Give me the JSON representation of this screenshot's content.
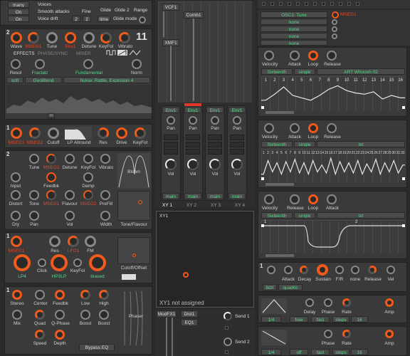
{
  "osc_header": {
    "many": "many",
    "on1": "On",
    "on2": "On",
    "voices": "Voices",
    "smooth": "Smooth attacks",
    "drift": "Voice drift",
    "fine": "Fine",
    "fine_a": "2",
    "fine_b": "2",
    "glide": "Glide",
    "glide2": "Glide 2",
    "range": "Range",
    "mode_btn": "time",
    "glide_mode": "Glide mode"
  },
  "osc": {
    "index": "2",
    "big_num": "11",
    "knobs": [
      "Wave",
      "MSEG1",
      "Tune",
      "Env1",
      "Detune",
      "KeyFol",
      "Vibrato"
    ],
    "tabs": [
      "EFFECTS",
      "PHASE/SYNC",
      "MIXER"
    ],
    "resol": "Resol",
    "fractalz": "Fractalz",
    "fundamental": "Fundamental",
    "norm": "Norm",
    "soft": "soft",
    "geoblend": "GeoBlend",
    "noise": "Noise: Rattle, Explosion 4"
  },
  "filter1": {
    "index": "1",
    "labels": [
      "MSEG1",
      "MSEG2",
      "Cutoff",
      "LP Allround",
      "Res",
      "Drive",
      "KeyFol"
    ]
  },
  "comb": {
    "index": "2",
    "row1": [
      "Tune",
      "MSEG2",
      "Detune",
      "KeyFol",
      "Vibrato",
      "Blown"
    ],
    "row2": [
      "Input",
      "Feedbk",
      "Damp"
    ],
    "row3": [
      "Distort",
      "Tone",
      "MSEG1",
      "Flavour",
      "MSEG2",
      "PreFill"
    ],
    "row4": [
      "Dry",
      "Pan",
      "Vol",
      "Width",
      "Tone/Flavour"
    ]
  },
  "filter2": {
    "index": "1",
    "labels": [
      "MSEG1",
      "Res",
      "LFO1",
      "FM",
      "LP4",
      "Click",
      "HP3LP",
      "KeyFol",
      "biased",
      "Cutoff/Offset"
    ]
  },
  "phaser": {
    "index": "1",
    "labels": [
      "Stereo",
      "Center",
      "Feedbk",
      "Low",
      "High",
      "Mix",
      "Quad",
      "Q-Phase",
      "Boost",
      "Boost",
      "Speed",
      "Depth",
      "Phaser",
      "Bypass EQ"
    ]
  },
  "matrix": {
    "vcf1": "VCF1",
    "comb1": "Comb1",
    "xmf1": "XMF1",
    "channels": [
      {
        "env": "Env1",
        "pan": "Pan",
        "vol": "Vol",
        "out": "main"
      },
      {
        "env": "Env1",
        "pan": "Pan",
        "vol": "Vol",
        "out": "main"
      },
      {
        "env": "Env1",
        "pan": "Pan",
        "vol": "Vol",
        "out": "main"
      },
      {
        "env": "Env1",
        "pan": "Pan",
        "vol": "Vol",
        "out": "main"
      }
    ],
    "xy_tabs": [
      "XY 1",
      "XY 2",
      "XY 3",
      "XY 4"
    ],
    "xy_title": "XY1",
    "xy_status": "XY1 not assigned",
    "fx": {
      "modfx": "ModFX1",
      "dist": "Dist1",
      "eq": "EQ1",
      "send1": "Send 1",
      "send2": "Send 2"
    }
  },
  "mod_list": {
    "items": [
      "OSC1: Tune",
      "none",
      "none",
      "none",
      "none"
    ],
    "target": "MSEG1"
  },
  "mseg1": {
    "labels": [
      "Velocity",
      "Attack",
      "Loop",
      "Release"
    ],
    "sync": "Sixteenth",
    "single": "single",
    "preset": "ART Whoosh 02",
    "steps": [
      "1",
      "2",
      "3",
      "4",
      "5",
      "6",
      "7",
      "8",
      "9",
      "10",
      "11",
      "12",
      "13",
      "14",
      "15",
      "16"
    ],
    "levels": [
      0.3,
      0.55,
      0.85,
      0.5,
      0.4,
      0.3,
      0.5,
      0.75,
      0.9,
      0.7,
      0.6,
      0.55,
      0.65,
      0.35,
      0.5,
      0.4
    ]
  },
  "mseg2": {
    "labels": [
      "Velocity",
      "Attack",
      "Loop",
      "Release"
    ],
    "sync": "Sixteenth",
    "single": "single",
    "preset": "txt",
    "steps": [
      "1",
      "2",
      "3",
      "4",
      "5",
      "6",
      "7",
      "8",
      "9",
      "10",
      "11",
      "12",
      "13",
      "14",
      "15",
      "16",
      "17",
      "18",
      "19",
      "20",
      "21",
      "22",
      "23",
      "24",
      "25",
      "26",
      "27",
      "28",
      "29",
      "30",
      "31",
      "32"
    ],
    "levels": [
      0.2,
      0.8,
      0.3,
      0.7,
      0.2,
      0.75,
      0.3,
      0.85,
      0.25,
      0.7,
      0.2,
      0.8,
      0.3,
      0.6,
      0.25,
      0.9,
      0.2,
      0.75,
      0.3,
      0.7,
      0.25,
      0.8,
      0.2,
      0.65,
      0.3,
      0.85,
      0.2,
      0.7,
      0.3,
      0.8,
      0.25,
      0.6
    ]
  },
  "mseg3": {
    "labels": [
      "Velocity",
      "Release",
      "Loop",
      "Attack"
    ],
    "sync": "Sixteenth",
    "single": "single",
    "preset": "txt",
    "steps": [
      "1",
      "2"
    ]
  },
  "env": {
    "index": "1",
    "labels": [
      "Attack",
      "Decay",
      "Sustain",
      "F/R",
      "none",
      "Release",
      "Vel"
    ],
    "mode": "8dX",
    "curve": "quadric"
  },
  "lfo1": {
    "labels": [
      "Delay",
      "Phase",
      "Rate",
      "Amp"
    ],
    "boxes": [
      "1/4",
      "free",
      "fast",
      "steps",
      "16"
    ]
  },
  "lfo2": {
    "labels": [
      "Phase",
      "Rate",
      "Amp"
    ],
    "boxes": [
      "1/4",
      "off",
      "fast",
      "steps",
      "16"
    ]
  },
  "colors": {
    "accent": "#f05a1a",
    "value": "#58d88a",
    "panel": "#3a3a3a",
    "bg": "#2a2a2a"
  }
}
